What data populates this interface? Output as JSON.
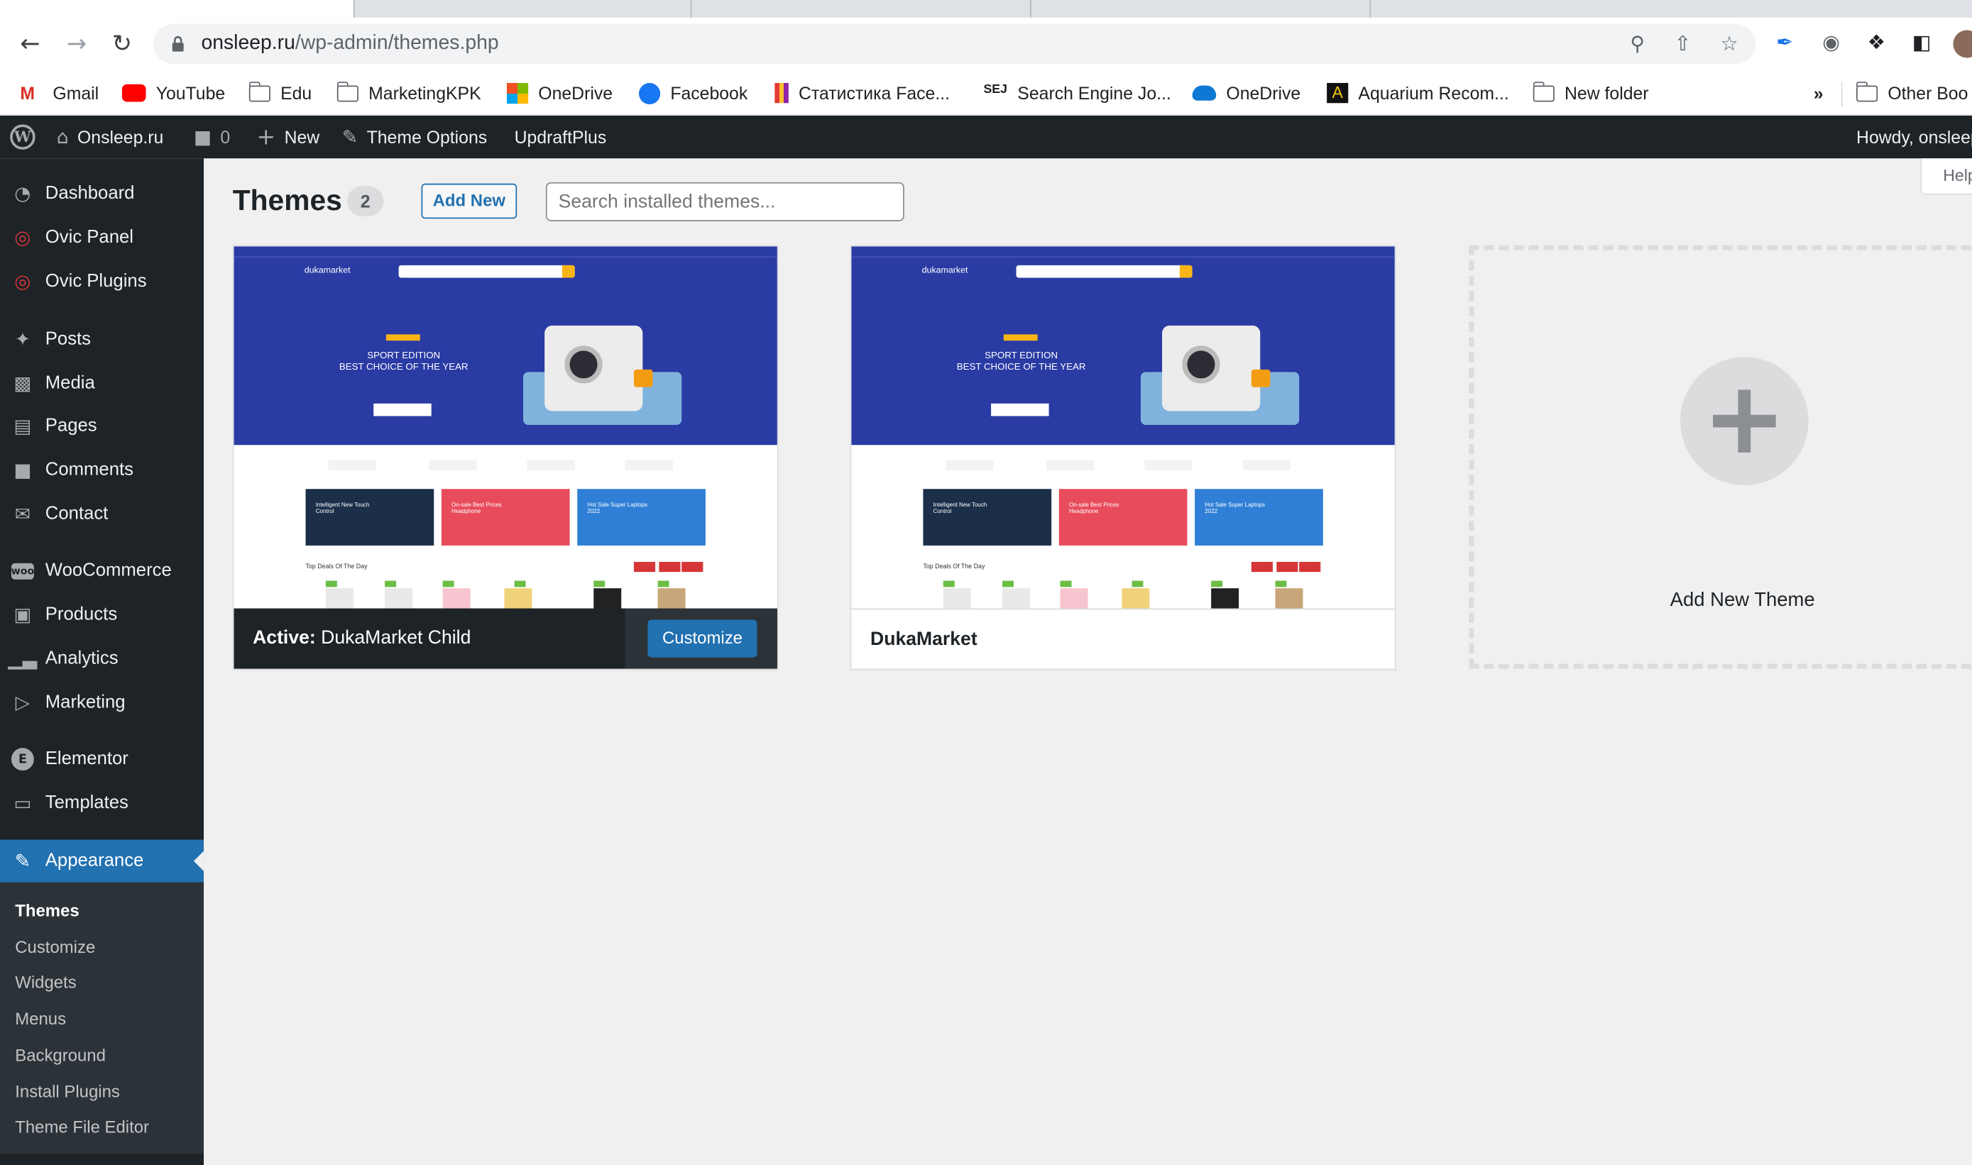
{
  "browser": {
    "url_host": "onsleep.ru",
    "url_path": "/wp-admin/themes.php",
    "bookmarks": [
      "Gmail",
      "YouTube",
      "Edu",
      "MarketingKPK",
      "OneDrive",
      "Facebook",
      "Статистика Face...",
      "Search Engine Jo...",
      "OneDrive",
      "Aquarium Recom...",
      "New folder"
    ],
    "overflow": "»",
    "other_bookmarks": "Other Boo"
  },
  "adminbar": {
    "site": "Onsleep.ru",
    "comments_count": "0",
    "new_label": "New",
    "theme_options": "Theme Options",
    "updraft": "UpdraftPlus",
    "howdy": "Howdy, onsleep"
  },
  "sidebar": {
    "items": [
      "Dashboard",
      "Ovic Panel",
      "Ovic Plugins",
      "Posts",
      "Media",
      "Pages",
      "Comments",
      "Contact",
      "WooCommerce",
      "Products",
      "Analytics",
      "Marketing",
      "Elementor",
      "Templates",
      "Appearance"
    ],
    "submenu": [
      "Themes",
      "Customize",
      "Widgets",
      "Menus",
      "Background",
      "Install Plugins",
      "Theme File Editor"
    ]
  },
  "page": {
    "title": "Themes",
    "count": "2",
    "add_new": "Add New",
    "search_placeholder": "Search installed themes...",
    "help": "Help"
  },
  "themes": [
    {
      "active_prefix": "Active:",
      "name": "DukaMarket Child",
      "action": "Customize"
    },
    {
      "name": "DukaMarket"
    }
  ],
  "add_theme_label": "Add New Theme",
  "screenshot": {
    "logo": "dukamarket",
    "hero_line1": "SPORT EDITION",
    "hero_line2": "BEST CHOICE OF THE YEAR",
    "promo1": "Intelligent New Touch Control",
    "promo2": "On-sale Best Prices Headphone",
    "promo3": "Hot Sale Super Laptops 2022",
    "deals": "Top Deals Of The Day"
  },
  "colors": {
    "accent": "#2271b1",
    "adminbar": "#1d2327",
    "hero": "#2a3ba4"
  }
}
